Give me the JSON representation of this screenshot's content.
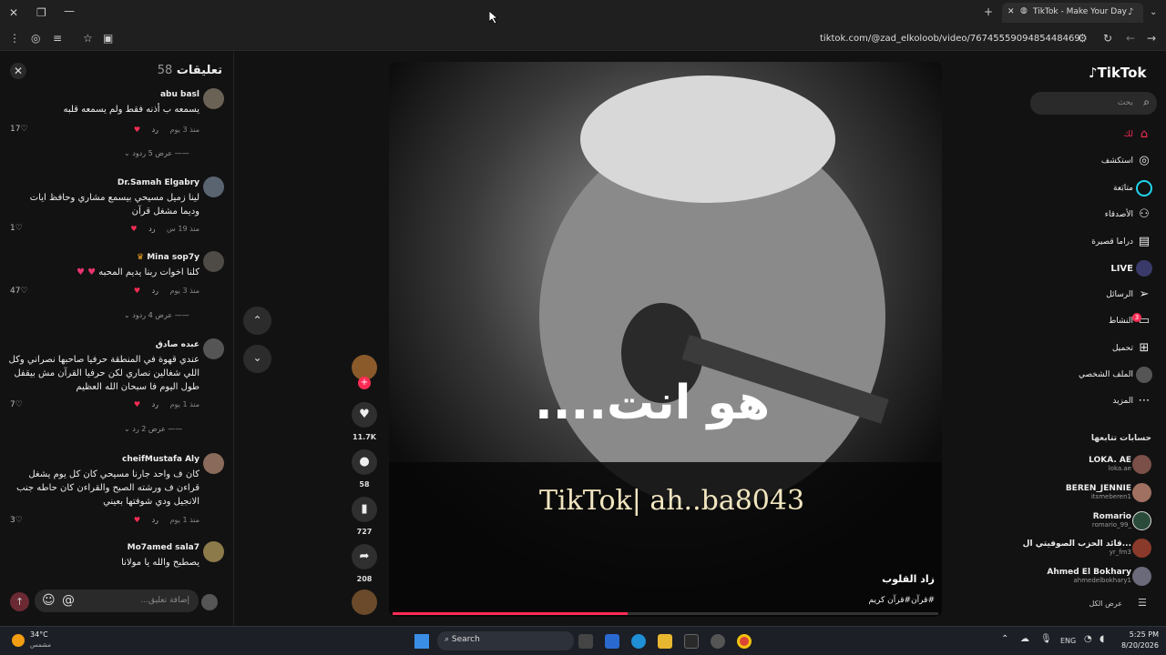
{
  "browser": {
    "tab_title": "TikTok - Make Your Day",
    "url": "tiktok.com/@zad_elkoloob/video/7674555909485448469"
  },
  "comments": {
    "title": "تعليقات",
    "count": "58",
    "items": [
      {
        "name": "abu basl",
        "text": "يسمعه ب أذنه فقط ولم يسمعه قلبه",
        "time": "منذ 3 يوم",
        "reply": "رد",
        "likes": "17",
        "more": "عرض 5 ردود"
      },
      {
        "name": "Dr.Samah Elgabry",
        "text": "لينا زميل مسيحي بيسمع مشاري وحافظ ايات وديما مشغل قرآن",
        "time": "منذ 19 س",
        "reply": "رد",
        "likes": "1",
        "more": ""
      },
      {
        "name": "Mina sop7y",
        "text": "كلنا اخوات ربنا يديم المحبه",
        "time": "منذ 3 يوم",
        "reply": "رد",
        "likes": "47",
        "more": "عرض 4 ردود"
      },
      {
        "name": "عبده صادق",
        "text": "عندي قهوة في المنطقة حرفيا صاحبها نصراني وكل اللي شغالين نصاري لكن حرفيا القرآن مش بيقفل طول اليوم فا سبحان الله العظيم",
        "time": "منذ 1 يوم",
        "reply": "رد",
        "likes": "7",
        "more": "عرض 2 رد"
      },
      {
        "name": "cheifMustafa Aly",
        "text": "كان ف واحد جارنا مسيحي كان كل يوم يشغل قراءن ف ورشته الصبح والقراءن كان حاطه جنب الانجيل ودي شوفتها بعيني",
        "time": "منذ 1 يوم",
        "reply": "رد",
        "likes": "3",
        "more": ""
      },
      {
        "name": "Mo7amed sala7",
        "text": "يصطبح والله يا مولانا",
        "time": "",
        "reply": "",
        "likes": "",
        "more": ""
      }
    ],
    "input_placeholder": "إضافة تعليق..."
  },
  "video": {
    "overlay_text": "هو انت....",
    "watermark": "TikTok| ah..ba8043",
    "author": "زاد القلوب",
    "caption": "#قرآن#قرآن كريم",
    "progress": 0.43
  },
  "actions": {
    "likes": "11.7K",
    "comments": "58",
    "saves": "727",
    "shares": "208"
  },
  "sidebar": {
    "logo": "TikTok",
    "search_placeholder": "بحث",
    "items": [
      {
        "label": "لك",
        "icon": "home-icon"
      },
      {
        "label": "استكشف",
        "icon": "compass-icon"
      },
      {
        "label": "متابَعة",
        "icon": "following-icon"
      },
      {
        "label": "الأصدقاء",
        "icon": "friends-icon"
      },
      {
        "label": "دراما قصيرة",
        "icon": "drama-icon"
      },
      {
        "label": "LIVE",
        "icon": "live-icon"
      },
      {
        "label": "الرسائل",
        "icon": "send-icon"
      },
      {
        "label": "النشاط",
        "icon": "activity-icon"
      },
      {
        "label": "تحميل",
        "icon": "upload-icon"
      },
      {
        "label": "الملف الشخصي",
        "icon": "profile-icon"
      },
      {
        "label": "المزيد",
        "icon": "more-icon"
      }
    ],
    "following_title": "حسابات تتابعها",
    "following": [
      {
        "name": "LOKA. AE",
        "handle": "loka.ae"
      },
      {
        "name": "BEREN_JENNIE",
        "handle": "itsmeberen1"
      },
      {
        "name": "Romario",
        "handle": "romario_99_"
      },
      {
        "name": "قائد الحزب الصوفيتي ال...",
        "handle": "yr_fm3"
      },
      {
        "name": "Ahmed El Bokhary",
        "handle": "ahmedelbokhary1"
      }
    ],
    "show_all": "عرض الكل",
    "activity_badge": "3"
  },
  "taskbar": {
    "weather_temp": "34°C",
    "weather_desc": "مشمس",
    "search": "Search",
    "lang": "ENG",
    "time": "5:25 PM",
    "date": "8/20/2026"
  },
  "colors": {
    "accent": "#fe2c55",
    "bg": "#121212"
  }
}
